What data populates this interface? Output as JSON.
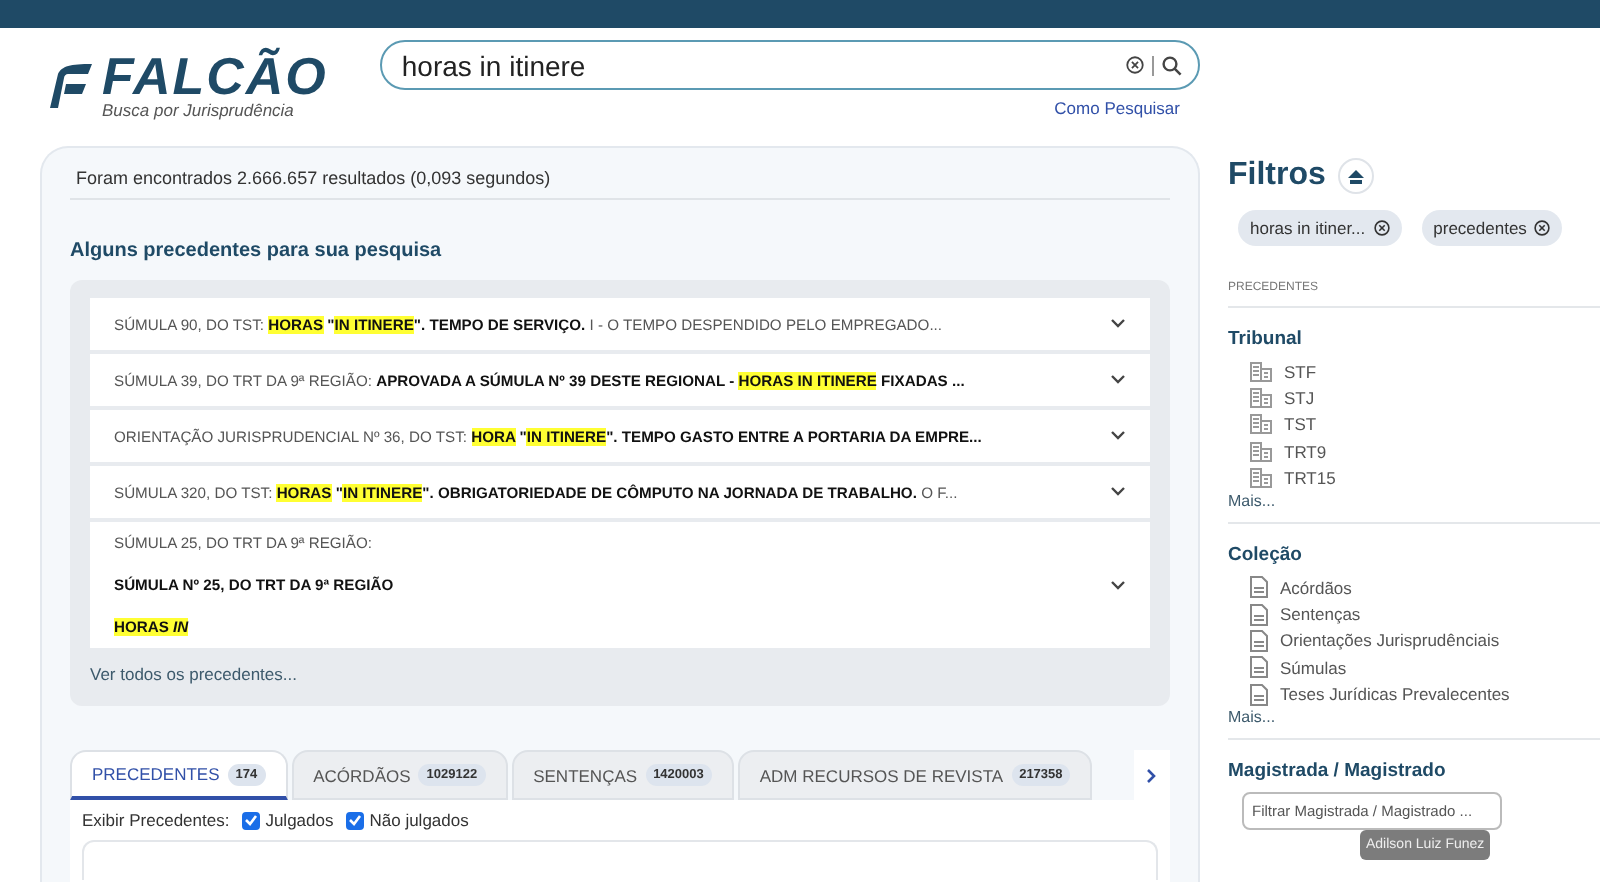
{
  "logo": {
    "name": "FALCÃO",
    "tagline": "Busca por Jurisprudência"
  },
  "search": {
    "value": "horas in itinere",
    "help_link": "Como Pesquisar"
  },
  "results": {
    "summary": "Foram encontrados 2.666.657 resultados (0,093 segundos)",
    "heading": "Alguns precedentes para sua pesquisa",
    "see_all": "Ver todos os precedentes..."
  },
  "precedents": [
    {
      "expanded": false,
      "lines": [
        [
          {
            "text": "SÚMULA 90, DO TST: ",
            "bold": false,
            "highlighted": false
          },
          {
            "text": "HORAS",
            "bold": true,
            "highlighted": true
          },
          {
            "text": " \"",
            "bold": true,
            "highlighted": false
          },
          {
            "text": "IN ITINERE",
            "bold": true,
            "highlighted": true
          },
          {
            "text": "\". TEMPO DE SERVIÇO.",
            "bold": true,
            "highlighted": false
          },
          {
            "text": " I - O TEMPO DESPENDIDO PELO EMPREGADO...",
            "bold": false,
            "highlighted": false
          }
        ]
      ]
    },
    {
      "expanded": false,
      "lines": [
        [
          {
            "text": "SÚMULA 39, DO TRT DA 9ª REGIÃO: ",
            "bold": false,
            "highlighted": false
          },
          {
            "text": "APROVADA A SÚMULA Nº 39 DESTE REGIONAL - ",
            "bold": true,
            "highlighted": false
          },
          {
            "text": "HORAS IN ITINERE",
            "bold": true,
            "highlighted": true
          },
          {
            "text": " FIXADAS ...",
            "bold": true,
            "highlighted": false
          }
        ]
      ]
    },
    {
      "expanded": false,
      "lines": [
        [
          {
            "text": "ORIENTAÇÃO JURISPRUDENCIAL Nº 36, DO TST: ",
            "bold": false,
            "highlighted": false
          },
          {
            "text": "HORA",
            "bold": true,
            "highlighted": true
          },
          {
            "text": " \"",
            "bold": true,
            "highlighted": false
          },
          {
            "text": "IN ITINERE",
            "bold": true,
            "highlighted": true
          },
          {
            "text": "\". TEMPO GASTO ENTRE A PORTARIA DA EMPRE...",
            "bold": true,
            "highlighted": false
          }
        ]
      ]
    },
    {
      "expanded": false,
      "lines": [
        [
          {
            "text": "SÚMULA 320, DO TST: ",
            "bold": false,
            "highlighted": false
          },
          {
            "text": "HORAS",
            "bold": true,
            "highlighted": true
          },
          {
            "text": " \"",
            "bold": true,
            "highlighted": false
          },
          {
            "text": "IN ITINERE",
            "bold": true,
            "highlighted": true
          },
          {
            "text": "\". OBRIGATORIEDADE DE CÔMPUTO NA JORNADA DE TRABALHO.",
            "bold": true,
            "highlighted": false
          },
          {
            "text": " O F...",
            "bold": false,
            "highlighted": false
          }
        ]
      ]
    },
    {
      "expanded": true,
      "lines": [
        [
          {
            "text": "SÚMULA 25, DO TRT DA 9ª REGIÃO:",
            "bold": false,
            "highlighted": false
          }
        ],
        [
          {
            "text": "SÚMULA Nº 25, DO TRT DA 9ª REGIÃO",
            "bold": true,
            "highlighted": false
          }
        ],
        [
          {
            "text": "HORAS *IN*",
            "bold": true,
            "highlighted": true
          }
        ]
      ]
    }
  ],
  "tabs": [
    {
      "label": "PRECEDENTES",
      "count": "174",
      "selected": true
    },
    {
      "label": "ACÓRDÃOS",
      "count": "1029122",
      "selected": false
    },
    {
      "label": "SENTENÇAS",
      "count": "1420003",
      "selected": false
    },
    {
      "label": "ADM RECURSOS DE REVISTA",
      "count": "217358",
      "selected": false
    }
  ],
  "display_filter": {
    "label": "Exibir Precedentes:",
    "options": [
      {
        "label": "Julgados",
        "checked": true
      },
      {
        "label": "Não julgados",
        "checked": true
      }
    ]
  },
  "filters": {
    "title": "Filtros",
    "chips": [
      "horas in itiner...",
      "precedentes"
    ],
    "section_label": "PRECEDENTES",
    "groups": [
      {
        "title": "Tribunal",
        "kind": "court",
        "items": [
          "STF",
          "STJ",
          "TST",
          "TRT9",
          "TRT15"
        ],
        "more": "Mais..."
      },
      {
        "title": "Coleção",
        "kind": "document",
        "items": [
          "Acórdãos",
          "Sentenças",
          "Orientações Jurisprudênciais",
          "Súmulas",
          "Teses Jurídicas Prevalecentes"
        ],
        "more": "Mais..."
      }
    ],
    "judge": {
      "title": "Magistrada / Magistrado",
      "placeholder": "Filtrar Magistrada / Magistrado ...",
      "tooltip": "Adilson Luiz Funez"
    }
  }
}
